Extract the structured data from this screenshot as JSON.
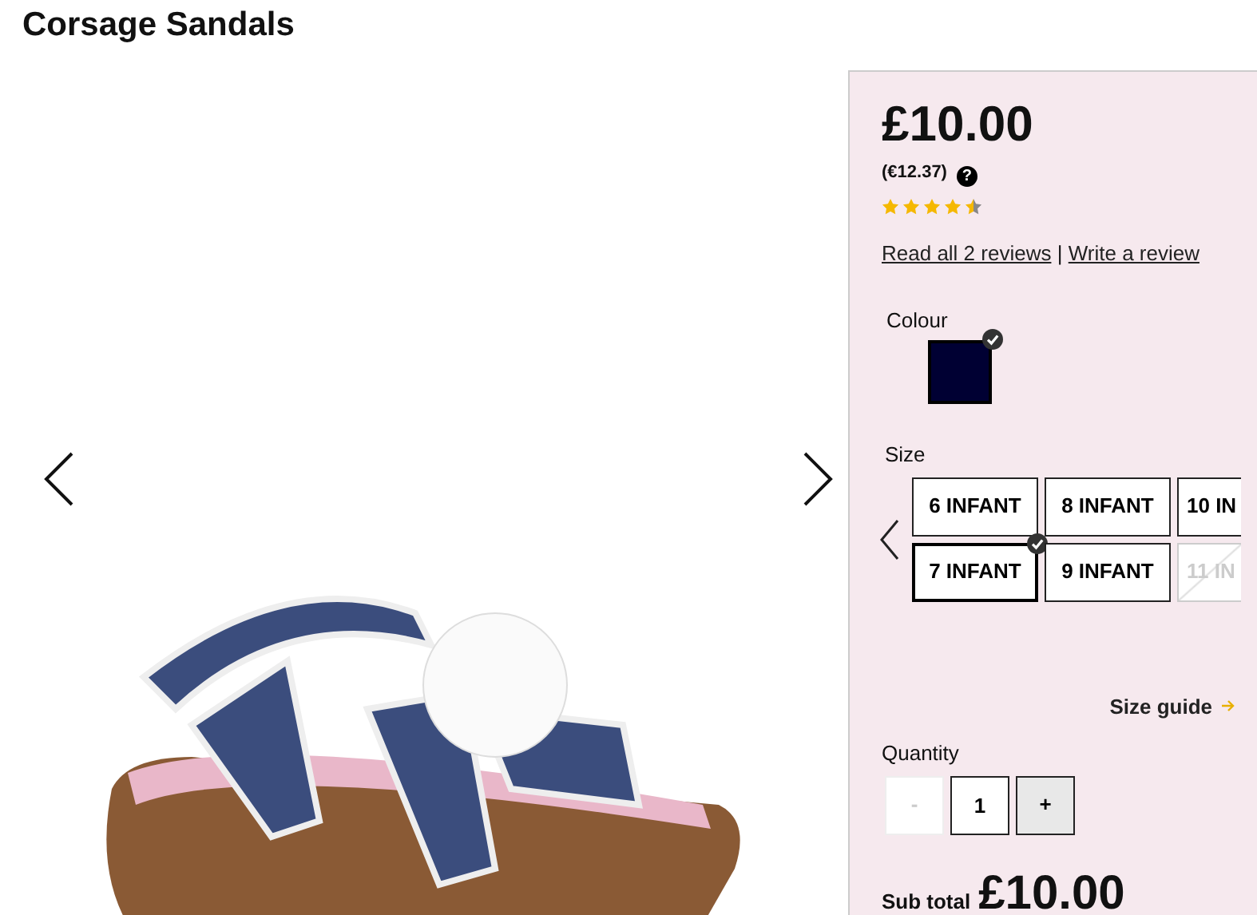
{
  "title": "Corsage Sandals",
  "price": {
    "main": "£10.00",
    "converted": "(€12.37)",
    "help": "?"
  },
  "rating": {
    "stars": 4.5
  },
  "reviews": {
    "read_link": "Read all 2 reviews",
    "separator": "|",
    "write_link": "Write a review"
  },
  "colour": {
    "label": "Colour",
    "swatches": [
      {
        "color": "#000033",
        "selected": true
      }
    ]
  },
  "size": {
    "label": "Size",
    "options": [
      {
        "label": "6 INFANT",
        "selected": false,
        "disabled": false
      },
      {
        "label": "8 INFANT",
        "selected": false,
        "disabled": false
      },
      {
        "label": "10 IN",
        "selected": false,
        "disabled": false
      },
      {
        "label": "7 INFANT",
        "selected": true,
        "disabled": false
      },
      {
        "label": "9 INFANT",
        "selected": false,
        "disabled": false
      },
      {
        "label": "11 IN",
        "selected": false,
        "disabled": true
      }
    ],
    "guide_link": "Size guide"
  },
  "quantity": {
    "label": "Quantity",
    "minus": "-",
    "minus_disabled": true,
    "value": "1",
    "plus": "+"
  },
  "subtotal": {
    "label": "Sub total",
    "value": "£10.00"
  }
}
